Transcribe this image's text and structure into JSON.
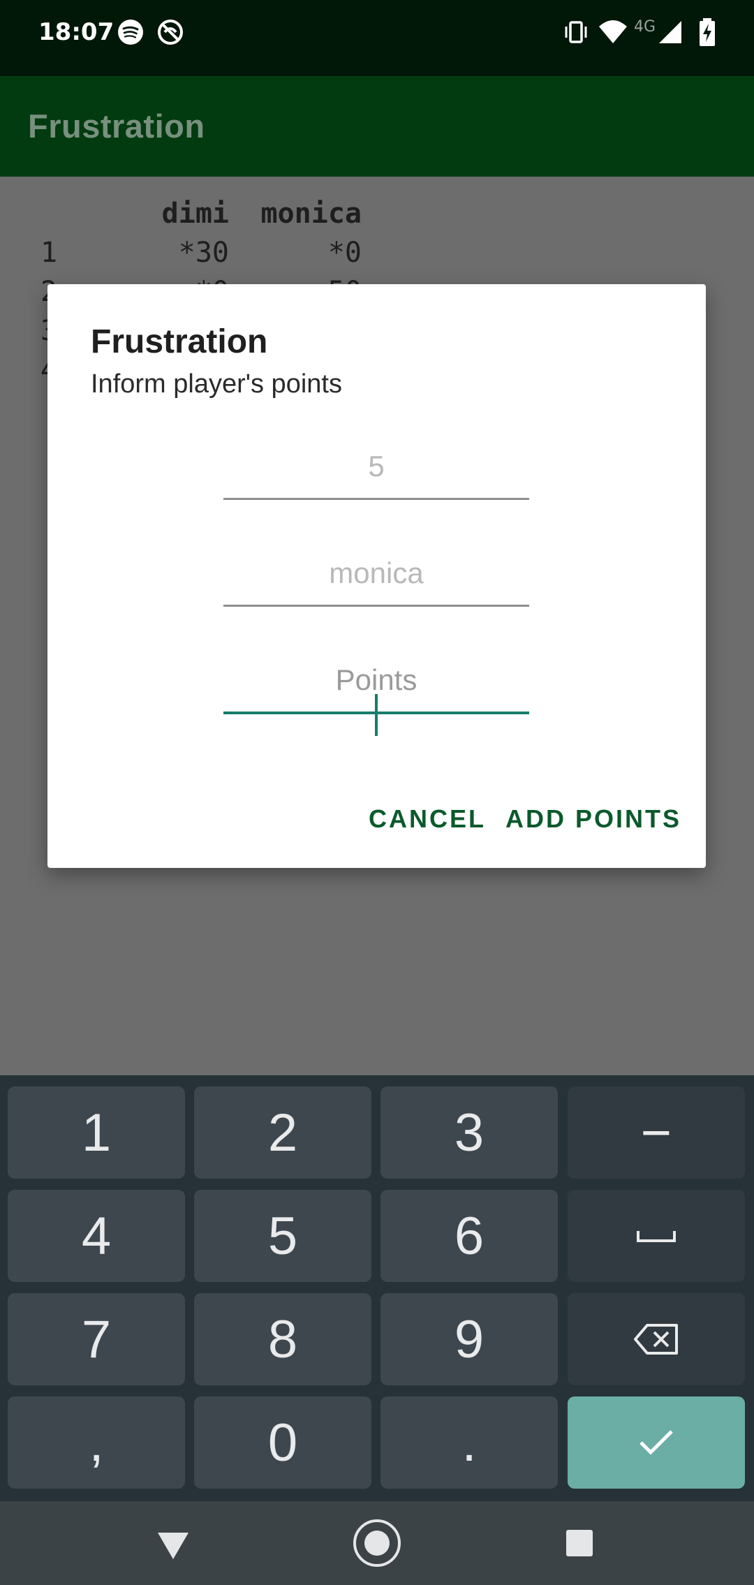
{
  "status_bar": {
    "time": "18:07",
    "icons": [
      "spotify-icon",
      "do-not-disturb-icon",
      "vibrate-icon",
      "wifi-icon",
      "signal-4g-icon",
      "battery-charging-icon"
    ],
    "network_label": "4G"
  },
  "app_bar": {
    "title": "Frustration"
  },
  "scores": {
    "headers": [
      "",
      "dimi",
      "monica"
    ],
    "rows": [
      [
        "1",
        "*30",
        "*0"
      ],
      [
        "2",
        "*0",
        "50"
      ],
      [
        "3",
        "",
        ""
      ],
      [
        "4",
        "",
        ""
      ]
    ]
  },
  "dialog": {
    "title": "Frustration",
    "message": "Inform player's points",
    "round_value": "5",
    "player_value": "monica",
    "points_placeholder": "Points",
    "cancel_label": "CANCEL",
    "confirm_label": "ADD POINTS"
  },
  "keyboard": {
    "rows": [
      [
        "1",
        "2",
        "3",
        "−"
      ],
      [
        "4",
        "5",
        "6",
        "space"
      ],
      [
        "7",
        "8",
        "9",
        "backspace"
      ],
      [
        ",",
        "0",
        ".",
        "done"
      ]
    ]
  },
  "colors": {
    "accent": "#177c6b",
    "app_bar": "#023b10",
    "status_bar": "#011708",
    "button_text": "#0b5a2c",
    "enter_key": "#6aaea6"
  }
}
